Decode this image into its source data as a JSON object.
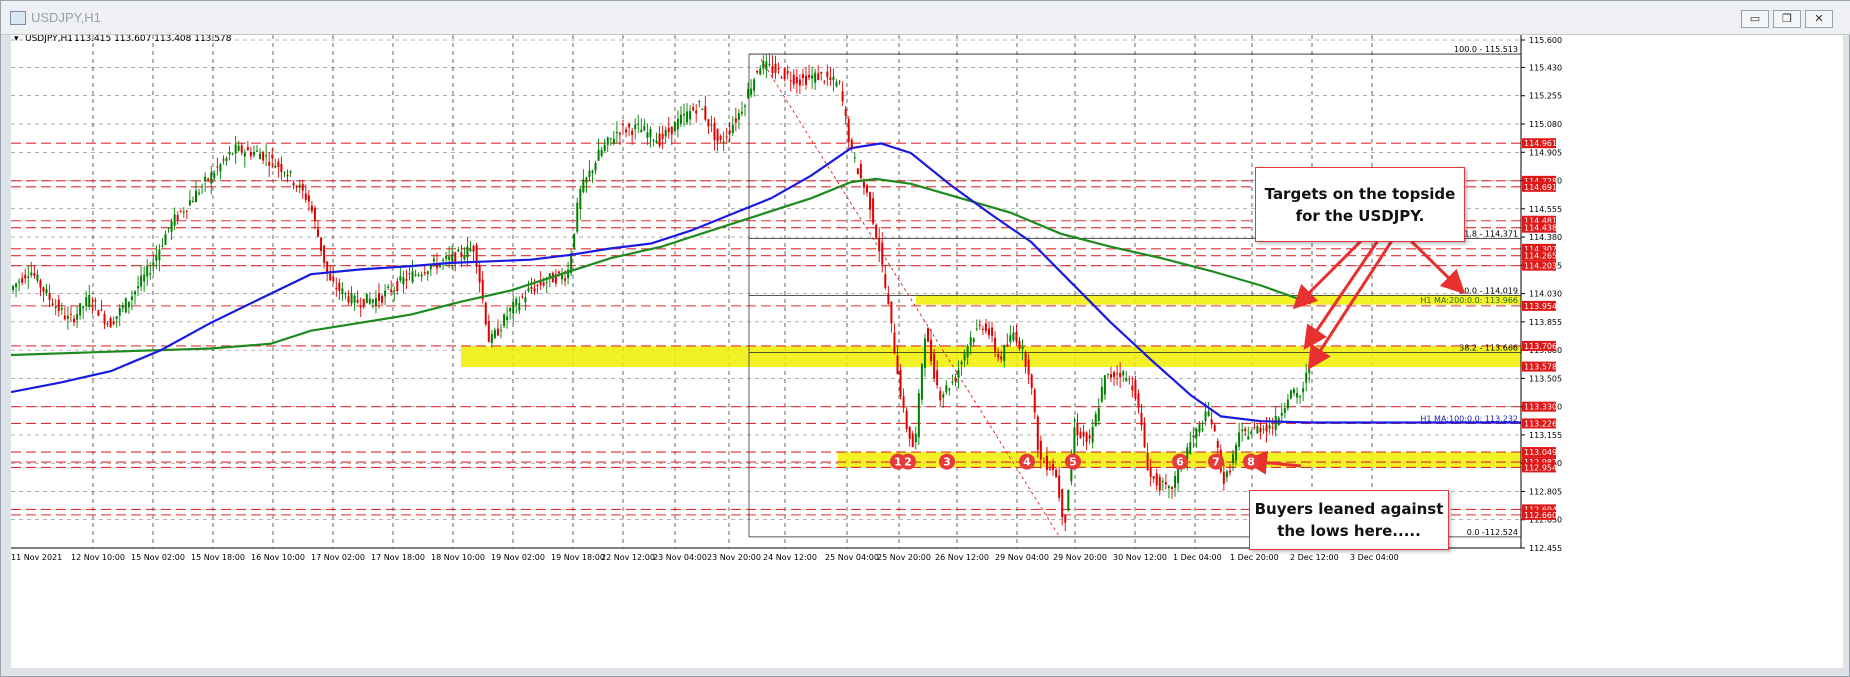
{
  "window": {
    "title": "USDJPY,H1",
    "buttons": {
      "minimize": "▭",
      "restore": "❐",
      "close": "✕"
    }
  },
  "chart_header": {
    "symbol": "USDJPY,H1",
    "ohlc": "113.415 113.607 113.408 113.578"
  },
  "colors": {
    "bull": "#008000",
    "bear": "#e00000",
    "ma100": "#1a1ae0",
    "ma200": "#1f8a1f",
    "highlight": "#f0f000",
    "red_level": "#e03030",
    "price_box": "#e01818"
  },
  "chart_data": {
    "type": "candlestick",
    "symbol": "USDJPY",
    "timeframe": "H1",
    "ylim": [
      112.455,
      115.6
    ],
    "y_ticks": [
      115.6,
      115.43,
      115.255,
      115.08,
      114.905,
      114.73,
      114.555,
      114.38,
      114.205,
      114.03,
      113.855,
      113.68,
      113.505,
      113.33,
      113.155,
      112.98,
      112.805,
      112.63,
      112.455
    ],
    "x_labels": [
      "11 Nov 2021",
      "12 Nov 10:00",
      "15 Nov 02:00",
      "15 Nov 18:00",
      "16 Nov 10:00",
      "17 Nov 02:00",
      "17 Nov 18:00",
      "18 Nov 10:00",
      "19 Nov 02:00",
      "19 Nov 18:00",
      "22 Nov 12:00",
      "23 Nov 04:00",
      "23 Nov 20:00",
      "24 Nov 12:00",
      "25 Nov 04:00",
      "25 Nov 20:00",
      "26 Nov 12:00",
      "29 Nov 04:00",
      "29 Nov 20:00",
      "30 Nov 12:00",
      "1 Dec 04:00",
      "1 Dec 20:00",
      "2 Dec 12:00",
      "3 Dec 04:00"
    ],
    "price_path": [
      [
        0,
        114.05
      ],
      [
        20,
        114.18
      ],
      [
        40,
        114.0
      ],
      [
        60,
        113.86
      ],
      [
        80,
        114.0
      ],
      [
        100,
        113.84
      ],
      [
        120,
        114.0
      ],
      [
        140,
        114.18
      ],
      [
        160,
        114.45
      ],
      [
        180,
        114.6
      ],
      [
        200,
        114.75
      ],
      [
        225,
        114.92
      ],
      [
        250,
        114.9
      ],
      [
        275,
        114.8
      ],
      [
        300,
        114.6
      ],
      [
        320,
        114.1
      ],
      [
        345,
        113.98
      ],
      [
        370,
        114.0
      ],
      [
        395,
        114.12
      ],
      [
        420,
        114.2
      ],
      [
        445,
        114.25
      ],
      [
        465,
        114.32
      ],
      [
        480,
        113.72
      ],
      [
        500,
        113.92
      ],
      [
        520,
        114.05
      ],
      [
        540,
        114.12
      ],
      [
        558,
        114.15
      ],
      [
        570,
        114.65
      ],
      [
        590,
        114.9
      ],
      [
        610,
        115.05
      ],
      [
        630,
        115.05
      ],
      [
        650,
        114.98
      ],
      [
        670,
        115.1
      ],
      [
        690,
        115.2
      ],
      [
        710,
        114.95
      ],
      [
        730,
        115.15
      ],
      [
        750,
        115.45
      ],
      [
        770,
        115.4
      ],
      [
        790,
        115.35
      ],
      [
        810,
        115.38
      ],
      [
        830,
        115.32
      ],
      [
        842,
        114.9
      ],
      [
        860,
        114.6
      ],
      [
        870,
        114.3
      ],
      [
        880,
        113.9
      ],
      [
        895,
        113.25
      ],
      [
        905,
        113.05
      ],
      [
        915,
        113.8
      ],
      [
        930,
        113.4
      ],
      [
        945,
        113.5
      ],
      [
        960,
        113.75
      ],
      [
        975,
        113.85
      ],
      [
        990,
        113.62
      ],
      [
        1005,
        113.8
      ],
      [
        1020,
        113.55
      ],
      [
        1030,
        113.0
      ],
      [
        1045,
        112.95
      ],
      [
        1055,
        112.6
      ],
      [
        1065,
        113.2
      ],
      [
        1080,
        113.1
      ],
      [
        1095,
        113.5
      ],
      [
        1110,
        113.55
      ],
      [
        1125,
        113.45
      ],
      [
        1140,
        112.9
      ],
      [
        1160,
        112.8
      ],
      [
        1180,
        113.1
      ],
      [
        1200,
        113.3
      ],
      [
        1215,
        112.85
      ],
      [
        1230,
        113.15
      ],
      [
        1250,
        113.2
      ],
      [
        1265,
        113.22
      ],
      [
        1280,
        113.42
      ],
      [
        1290,
        113.38
      ],
      [
        1300,
        113.58
      ]
    ],
    "levels_red": [
      {
        "value": 114.961,
        "label": "114.961"
      },
      {
        "value": 114.728,
        "label": "114.728"
      },
      {
        "value": 114.691,
        "label": "114.691"
      },
      {
        "value": 114.481,
        "label": "114.481"
      },
      {
        "value": 114.438,
        "label": "114.438"
      },
      {
        "value": 114.307,
        "label": "114.307"
      },
      {
        "value": 114.265,
        "label": "114.265"
      },
      {
        "value": 114.203,
        "label": "114.203"
      },
      {
        "value": 113.954,
        "label": "113.954"
      },
      {
        "value": 113.706,
        "label": "113.706"
      },
      {
        "value": 113.33,
        "label": "113.330"
      },
      {
        "value": 113.226,
        "label": "113.226"
      },
      {
        "value": 113.049,
        "label": "113.049"
      },
      {
        "value": 112.987,
        "label": "112.987"
      },
      {
        "value": 112.954,
        "label": "112.954"
      },
      {
        "value": 112.694,
        "label": "112.694"
      },
      {
        "value": 112.66,
        "label": "112.660"
      }
    ],
    "current_price": {
      "value": 113.578,
      "label": "113.578"
    },
    "fib_levels": [
      {
        "value": 115.513,
        "label": "100.0 - 115.513"
      },
      {
        "value": 114.371,
        "label": "61.8 - 114.371"
      },
      {
        "value": 114.019,
        "label": "50.0 - 114.019"
      },
      {
        "value": 113.666,
        "label": "38.2 - 113.666"
      },
      {
        "value": 112.524,
        "label": "0.0 -112.524"
      }
    ],
    "ma_labels": [
      {
        "value": 113.966,
        "label": "H1 MA:200:0.0: 113.966"
      },
      {
        "value": 113.232,
        "label": "H1 MA:100:0.0: 113.232"
      }
    ],
    "ma200": [
      [
        0,
        113.65
      ],
      [
        100,
        113.67
      ],
      [
        200,
        113.69
      ],
      [
        260,
        113.72
      ],
      [
        300,
        113.8
      ],
      [
        350,
        113.85
      ],
      [
        400,
        113.9
      ],
      [
        450,
        113.98
      ],
      [
        500,
        114.05
      ],
      [
        550,
        114.15
      ],
      [
        600,
        114.25
      ],
      [
        650,
        114.32
      ],
      [
        700,
        114.42
      ],
      [
        750,
        114.52
      ],
      [
        800,
        114.62
      ],
      [
        840,
        114.72
      ],
      [
        865,
        114.74
      ],
      [
        900,
        114.71
      ],
      [
        950,
        114.62
      ],
      [
        1000,
        114.53
      ],
      [
        1050,
        114.4
      ],
      [
        1100,
        114.32
      ],
      [
        1150,
        114.25
      ],
      [
        1200,
        114.17
      ],
      [
        1250,
        114.08
      ],
      [
        1300,
        113.97
      ]
    ],
    "ma100": [
      [
        0,
        113.42
      ],
      [
        50,
        113.48
      ],
      [
        100,
        113.55
      ],
      [
        150,
        113.68
      ],
      [
        200,
        113.85
      ],
      [
        250,
        114.0
      ],
      [
        300,
        114.15
      ],
      [
        350,
        114.18
      ],
      [
        400,
        114.2
      ],
      [
        440,
        114.22
      ],
      [
        480,
        114.23
      ],
      [
        520,
        114.24
      ],
      [
        560,
        114.27
      ],
      [
        600,
        114.31
      ],
      [
        640,
        114.34
      ],
      [
        680,
        114.42
      ],
      [
        720,
        114.52
      ],
      [
        760,
        114.62
      ],
      [
        800,
        114.76
      ],
      [
        840,
        114.93
      ],
      [
        870,
        114.96
      ],
      [
        900,
        114.9
      ],
      [
        940,
        114.7
      ],
      [
        980,
        114.52
      ],
      [
        1020,
        114.35
      ],
      [
        1060,
        114.1
      ],
      [
        1100,
        113.85
      ],
      [
        1140,
        113.62
      ],
      [
        1180,
        113.4
      ],
      [
        1210,
        113.27
      ],
      [
        1250,
        113.24
      ],
      [
        1300,
        113.232
      ],
      [
        1510,
        113.232
      ]
    ],
    "zones": [
      {
        "x0": 450,
        "x1": 1510,
        "y0": 113.705,
        "y1": 113.575
      },
      {
        "x0": 905,
        "x1": 1510,
        "y0": 114.02,
        "y1": 113.962
      },
      {
        "x0": 827,
        "x1": 1510,
        "y0": 113.049,
        "y1": 112.954
      }
    ],
    "markers": [
      {
        "x": 887,
        "label": "1"
      },
      {
        "x": 897,
        "label": "2"
      },
      {
        "x": 936,
        "label": "3"
      },
      {
        "x": 1016,
        "label": "4"
      },
      {
        "x": 1062,
        "label": "5"
      },
      {
        "x": 1169,
        "label": "6"
      },
      {
        "x": 1205,
        "label": "7"
      },
      {
        "x": 1240,
        "label": "8"
      }
    ]
  },
  "annotations": {
    "targets": "Targets on the topside for the USDJPY.",
    "buyers": "Buyers leaned against the lows here....."
  }
}
